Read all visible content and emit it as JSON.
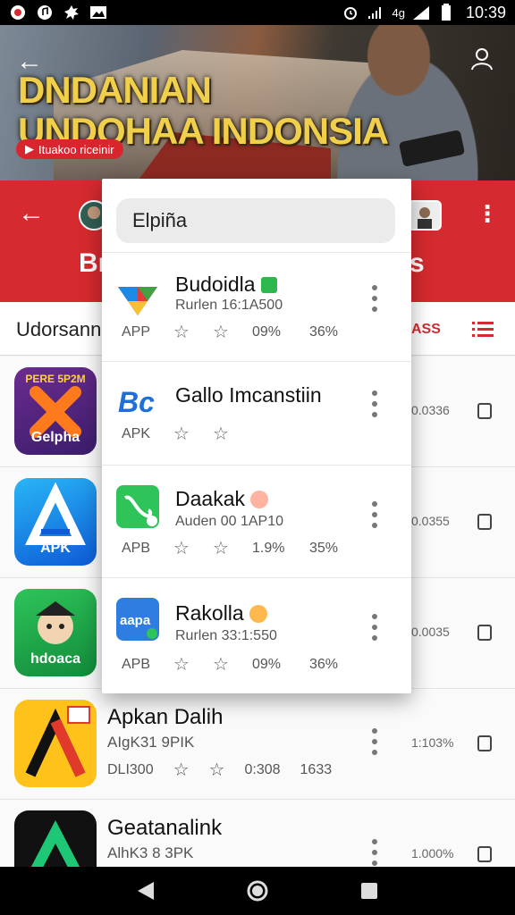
{
  "status_bar": {
    "time": "10:39",
    "battery_text": "",
    "signal_text": "4g",
    "icons": [
      "record-icon",
      "music-icon",
      "settings-icon",
      "gallery-icon",
      "alarm-icon",
      "signal-icon",
      "wifi-icon",
      "battery-icon"
    ]
  },
  "hero": {
    "title_line1": "DNDANIAN",
    "title_line2": "UNDOHAA INDONSIA",
    "badge": "Ituakoo riceinir"
  },
  "toolbar": {
    "left_text": "Br",
    "right_text": "s"
  },
  "tabs": {
    "left_label": "Udorsann",
    "right_label": "ASS"
  },
  "dropdown": {
    "search_value": "Elpiña",
    "items": [
      {
        "name": "Budoidla",
        "subtitle": "Rurlen 16:1A500",
        "kind": "APP",
        "pct1": "09%",
        "pct2": "36%"
      },
      {
        "name": "Gallo Imcanstiin",
        "subtitle": "",
        "kind": "APK",
        "pct1": "",
        "pct2": ""
      },
      {
        "name": "Daakak",
        "subtitle": "Auden 00 1AP10",
        "kind": "APB",
        "pct1": "1.9%",
        "pct2": "35%"
      },
      {
        "name": "Rakolla",
        "subtitle": "Rurlen 33:1:550",
        "kind": "APB",
        "pct1": "09%",
        "pct2": "36%"
      }
    ]
  },
  "background_list": [
    {
      "icon_label_top": "PERE 5P2M",
      "icon_label": "Gelpha",
      "side_stat": "0.0336"
    },
    {
      "icon_label": "APK",
      "side_stat": "0.0355"
    },
    {
      "icon_label": "hdoaca",
      "side_stat": "0.0035"
    },
    {
      "name": "Apkan Dalih",
      "sub": "AIgK31 9PIK",
      "meta_1": "DLI300",
      "meta_2": "0:308",
      "meta_3": "1633",
      "side_stat": "1:103%"
    },
    {
      "name": "Geatanalink",
      "sub": "AlhK3 8 3PK",
      "side_stat": "1.000%"
    }
  ],
  "colors": {
    "brand_red": "#d52a2f",
    "title_gold": "#f0d04a"
  }
}
